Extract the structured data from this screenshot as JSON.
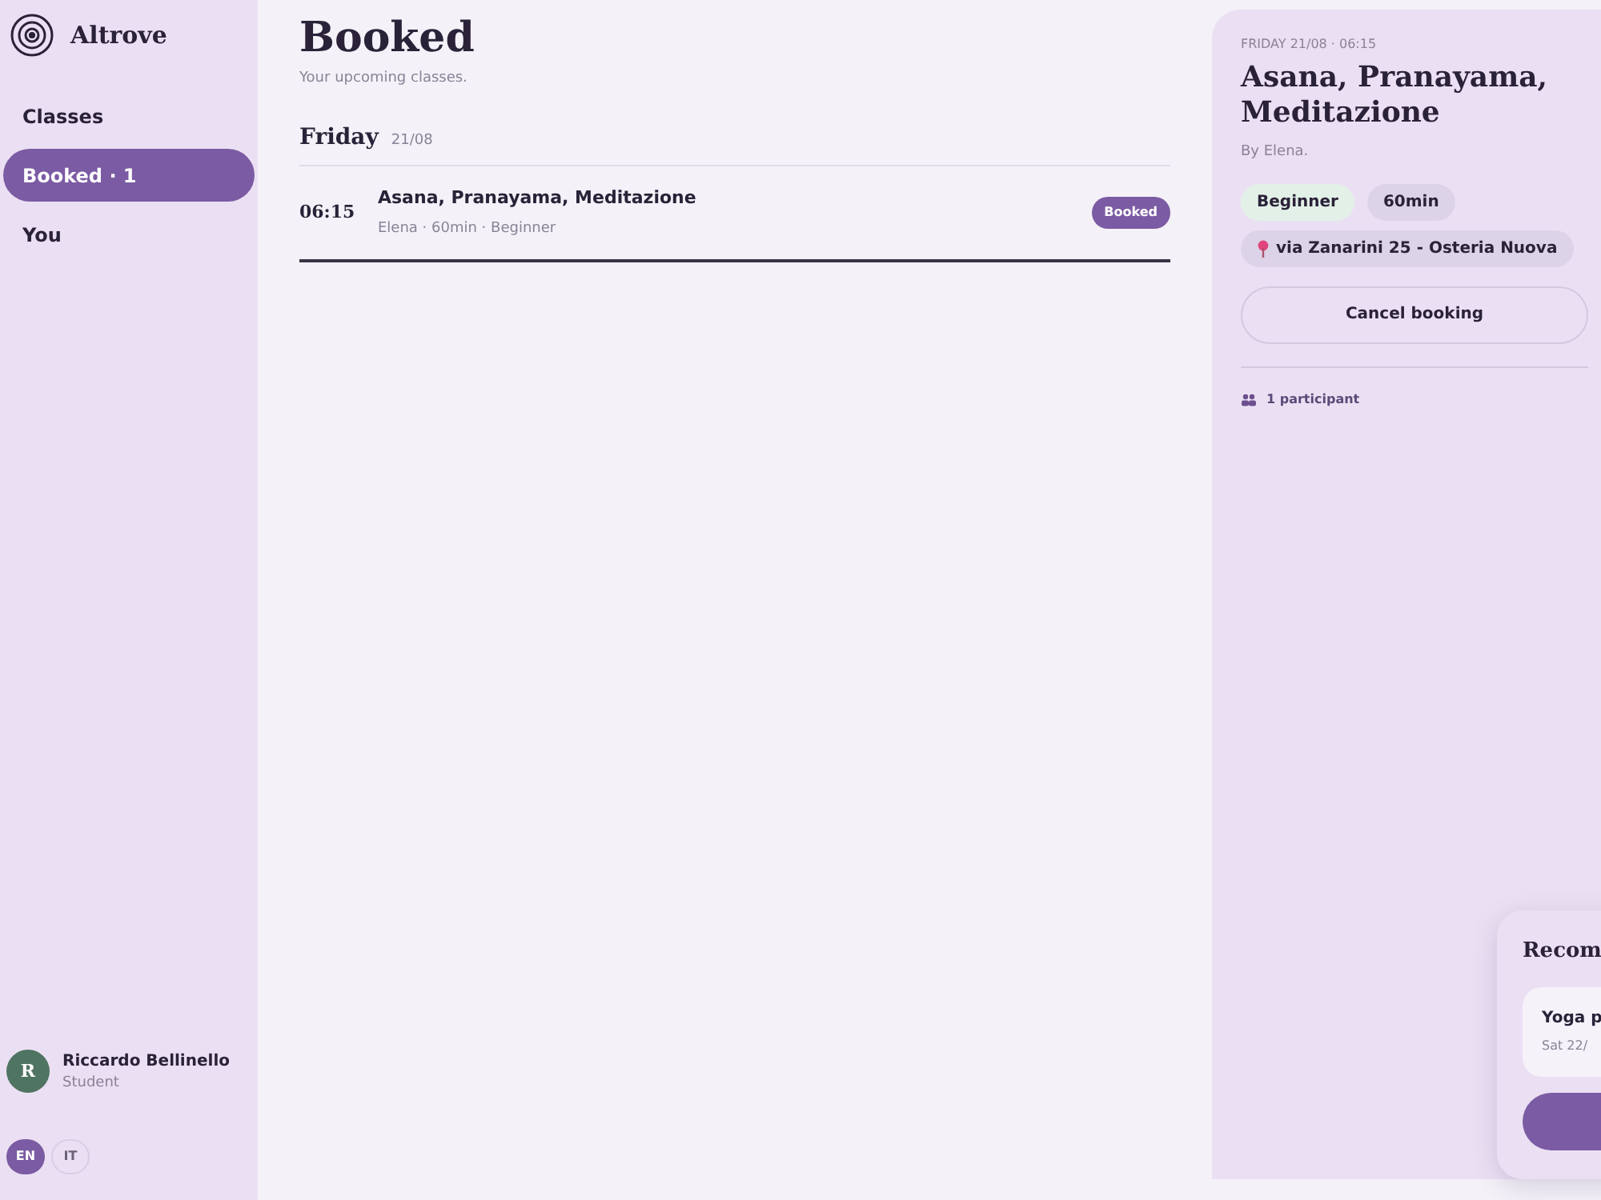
{
  "brand": {
    "name": "Altrove"
  },
  "nav": [
    {
      "label": "Classes",
      "selected": false
    },
    {
      "label": "Booked · 1",
      "selected": true
    },
    {
      "label": "You",
      "selected": false
    }
  ],
  "user": {
    "initial": "R",
    "name": "Riccardo Bellinello",
    "role": "Student"
  },
  "languages": [
    {
      "label": "EN",
      "selected": true
    },
    {
      "label": "IT",
      "selected": false
    }
  ],
  "page": {
    "title": "Booked",
    "subtitle": "Your upcoming classes."
  },
  "days": [
    {
      "day": "Friday",
      "date": "21/08",
      "classes": [
        {
          "time": "06:15",
          "name": "Asana, Pranayama, Meditazione",
          "meta": "Elena · 60min · Beginner",
          "badge": "Booked"
        }
      ]
    }
  ],
  "detail": {
    "when": "FRIDAY 21/08 · 06:15",
    "title": "Asana, Pranayama, Meditazione",
    "by": "By Elena.",
    "tags": [
      {
        "label": "Beginner",
        "kind": "level"
      },
      {
        "label": "60min",
        "kind": "plain"
      },
      {
        "label": "via Zanarini 25 - Osteria Nuova",
        "kind": "location"
      }
    ],
    "button": "Cancel booking",
    "participants": "1 participant"
  },
  "recommendation": {
    "title": "Recom",
    "item_name": "Yoga p",
    "item_date": "Sat 22/"
  }
}
